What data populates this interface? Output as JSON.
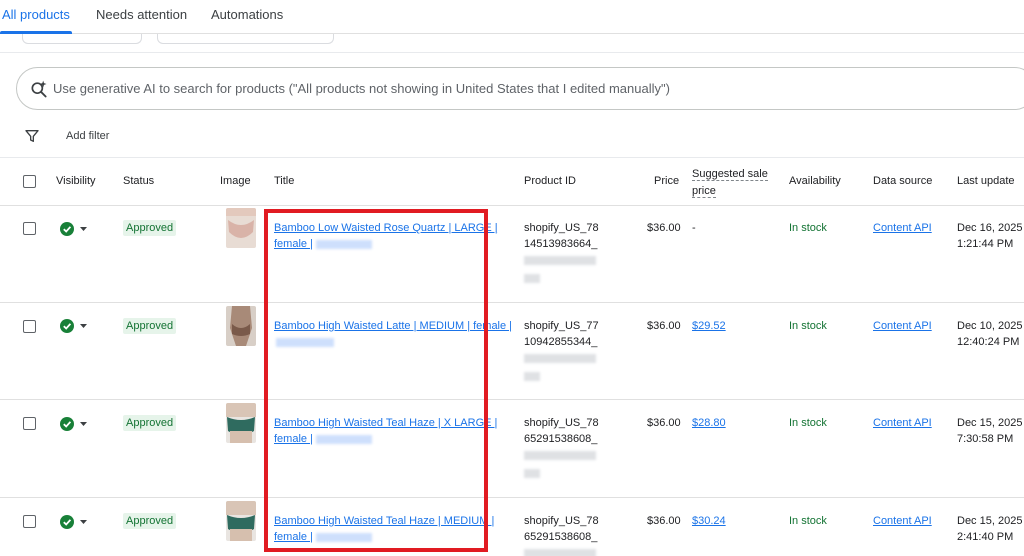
{
  "tabs": [
    "All products",
    "Needs attention",
    "Automations"
  ],
  "search": {
    "placeholder": "Use generative AI to search for products (\"All products not showing in United States that I edited manually\")"
  },
  "filter": {
    "label": "Add filter"
  },
  "table": {
    "headers": {
      "visibility": "Visibility",
      "status": "Status",
      "image": "Image",
      "title": "Title",
      "product_id": "Product ID",
      "price": "Price",
      "suggested_line1": "Suggested sale",
      "suggested_line2": "price",
      "availability": "Availability",
      "data_source": "Data source",
      "last_update": "Last update"
    },
    "rows": [
      {
        "status": "Approved",
        "title_line1": "Bamboo Low Waisted Rose Quartz | LARGE |",
        "title_line2": "female |",
        "id_line1": "shopify_US_78",
        "id_line2": "14513983664_",
        "price": "$36.00",
        "suggested": "-",
        "availability": "In stock",
        "data_source": "Content API",
        "date": "Dec 16, 2025",
        "time": "1:21:44 PM"
      },
      {
        "status": "Approved",
        "title_line1": "Bamboo High Waisted Latte | MEDIUM | female |",
        "title_line2": "",
        "id_line1": "shopify_US_77",
        "id_line2": "10942855344_",
        "price": "$36.00",
        "suggested": "$29.52",
        "availability": "In stock",
        "data_source": "Content API",
        "date": "Dec 10, 2025",
        "time": "12:40:24 PM"
      },
      {
        "status": "Approved",
        "title_line1": "Bamboo High Waisted Teal Haze | X LARGE |",
        "title_line2": "female |",
        "id_line1": "shopify_US_78",
        "id_line2": "65291538608_",
        "price": "$36.00",
        "suggested": "$28.80",
        "availability": "In stock",
        "data_source": "Content API",
        "date": "Dec 15, 2025",
        "time": "7:30:58 PM"
      },
      {
        "status": "Approved",
        "title_line1": "Bamboo High Waisted Teal Haze | MEDIUM |",
        "title_line2": "female |",
        "id_line1": "shopify_US_78",
        "id_line2": "65291538608_",
        "price": "$36.00",
        "suggested": "$30.24",
        "availability": "In stock",
        "data_source": "Content API",
        "date": "Dec 15, 2025",
        "time": "2:41:40 PM"
      }
    ]
  },
  "colors": {
    "accent": "#1a73e8",
    "approved_bg": "#e6f4ea",
    "approved_text": "#137333",
    "highlight": "#e11b22"
  },
  "icons": [
    "sparkle-search-icon",
    "filter-icon",
    "check-circle-icon",
    "chevron-down-icon"
  ]
}
